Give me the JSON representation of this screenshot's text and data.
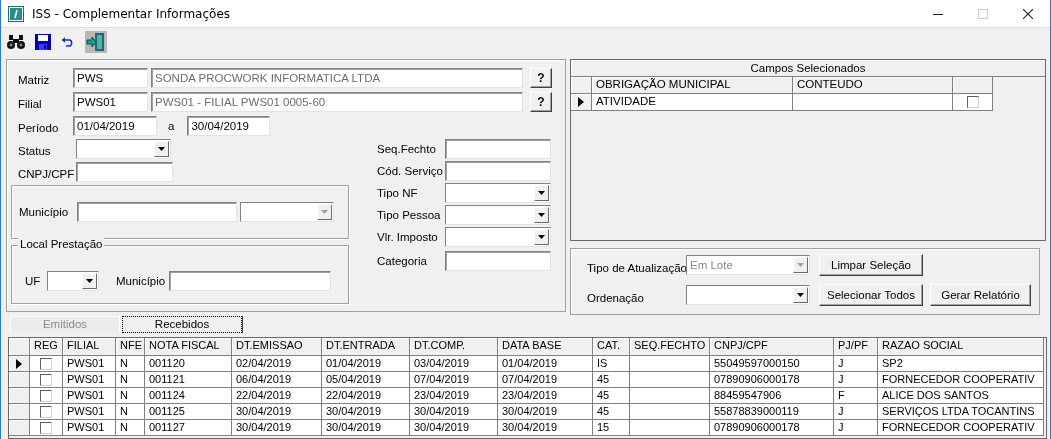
{
  "window": {
    "title": "ISS - Complementar Informações",
    "controls": [
      {
        "kind": "minimize",
        "disabled": false
      },
      {
        "kind": "maximize",
        "disabled": true
      },
      {
        "kind": "close",
        "disabled": false
      }
    ]
  },
  "filters": {
    "matriz": {
      "label": "Matriz",
      "code": "PWS",
      "name": "SONDA PROCWORK INFORMATICA LTDA",
      "lookup": "?"
    },
    "filial": {
      "label": "Filial",
      "code": "PWS01",
      "name": "PWS01 - FILIAL PWS01 0005-60",
      "lookup": "?"
    },
    "periodo": {
      "label": "Período",
      "from": "01/04/2019",
      "separator": "a",
      "to": "30/04/2019"
    },
    "status": {
      "label": "Status"
    },
    "cnpj": {
      "label": "CNPJ/CPF"
    },
    "municipio": {
      "label": "Município",
      "disabled": true
    },
    "local_prestacao": {
      "title": "Local Prestação",
      "uf_label": "UF",
      "municipio_label": "Município"
    },
    "extra": [
      {
        "label": "Seq.Fechto",
        "kind": "text"
      },
      {
        "label": "Cód. Serviço",
        "kind": "text"
      },
      {
        "label": "Tipo NF",
        "kind": "combo"
      },
      {
        "label": "Tipo Pessoa",
        "kind": "combo"
      },
      {
        "label": "Vlr. Imposto",
        "kind": "combo"
      },
      {
        "label": "Categoria",
        "kind": "text"
      }
    ]
  },
  "campos": {
    "title": "Campos Selecionados",
    "columns": [
      "OBRIGAÇÃO MUNICIPAL",
      "CONTEUDO"
    ],
    "rows": [
      {
        "obrigacao": "ATIVIDADE",
        "current": true,
        "checked": false
      }
    ]
  },
  "atualizacao": {
    "tipo_label": "Tipo de Atualização",
    "tipo_value": "Em Lote",
    "tipo_disabled": true,
    "ordenacao_label": "Ordenação",
    "buttons": [
      "Limpar Seleção",
      "Selecionar Todos",
      "Gerar Relatório"
    ]
  },
  "tabs": [
    {
      "label": "Emitidos",
      "selected": false
    },
    {
      "label": "Recebidos",
      "selected": true
    }
  ],
  "table": {
    "columns": [
      {
        "label": "REG",
        "kind": "check"
      },
      {
        "label": "FILIAL",
        "kind": "text"
      },
      {
        "label": "NFE",
        "kind": "text"
      },
      {
        "label": "NOTA FISCAL",
        "kind": "text"
      },
      {
        "label": "DT.EMISSAO",
        "kind": "text"
      },
      {
        "label": "DT.ENTRADA",
        "kind": "text"
      },
      {
        "label": "DT.COMP.",
        "kind": "text"
      },
      {
        "label": "DATA BASE",
        "kind": "text"
      },
      {
        "label": "CAT.",
        "kind": "text"
      },
      {
        "label": "SEQ.FECHTO",
        "kind": "text"
      },
      {
        "label": "CNPJ/CPF",
        "kind": "text"
      },
      {
        "label": "PJ/PF",
        "kind": "text"
      },
      {
        "label": "RAZAO SOCIAL",
        "kind": "text"
      }
    ],
    "rows": [
      {
        "current": true,
        "checked": false,
        "cells": [
          null,
          "PWS01",
          "N",
          "001120",
          "02/04/2019",
          "01/04/2019",
          "03/04/2019",
          "01/04/2019",
          "IS",
          null,
          "55049597000150",
          "J",
          "SP2"
        ]
      },
      {
        "current": false,
        "checked": false,
        "cells": [
          null,
          "PWS01",
          "N",
          "001121",
          "06/04/2019",
          "05/04/2019",
          "07/04/2019",
          "07/04/2019",
          "45",
          null,
          "07890906000178",
          "J",
          "FORNECEDOR COOPERATIV"
        ]
      },
      {
        "current": false,
        "checked": false,
        "cells": [
          null,
          "PWS01",
          "N",
          "001124",
          "22/04/2019",
          "22/04/2019",
          "23/04/2019",
          "23/04/2019",
          "45",
          null,
          "88459547906",
          "F",
          "ALICE DOS SANTOS"
        ]
      },
      {
        "current": false,
        "checked": false,
        "cells": [
          null,
          "PWS01",
          "N",
          "001125",
          "30/04/2019",
          "30/04/2019",
          "30/04/2019",
          "30/04/2019",
          "45",
          null,
          "55878839000119",
          "J",
          "SERVIÇOS LTDA TOCANTINS"
        ]
      },
      {
        "current": false,
        "checked": false,
        "cells": [
          null,
          "PWS01",
          "N",
          "001127",
          "30/04/2019",
          "30/04/2019",
          "30/04/2019",
          "30/04/2019",
          "15",
          null,
          "07890906000178",
          "J",
          "FORNECEDOR COOPERATIV"
        ]
      }
    ]
  }
}
